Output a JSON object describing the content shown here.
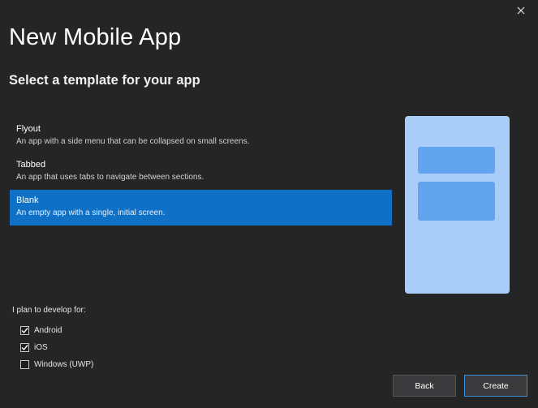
{
  "dialog": {
    "title": "New Mobile App",
    "subtitle": "Select a template for your app"
  },
  "templates": [
    {
      "name": "Flyout",
      "description": "An app with a side menu that can be collapsed on small screens.",
      "selected": false
    },
    {
      "name": "Tabbed",
      "description": "An app that uses tabs to navigate between sections.",
      "selected": false
    },
    {
      "name": "Blank",
      "description": "An empty app with a single, initial screen.",
      "selected": true
    }
  ],
  "platforms": {
    "label": "I plan to develop for:",
    "items": [
      {
        "name": "Android",
        "checked": true
      },
      {
        "name": "iOS",
        "checked": true
      },
      {
        "name": "Windows (UWP)",
        "checked": false
      }
    ]
  },
  "buttons": {
    "back": "Back",
    "create": "Create"
  },
  "colors": {
    "background": "#252526",
    "selection": "#0e71c6",
    "preview_bg": "#a9cdf8",
    "preview_block": "#63a4ef"
  }
}
